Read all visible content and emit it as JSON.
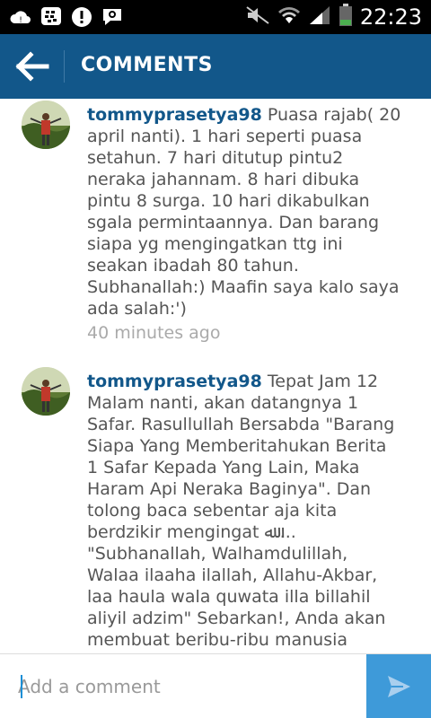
{
  "status_bar": {
    "time": "22:23",
    "icons": [
      "cloud-icon",
      "bbm-icon",
      "alert-icon",
      "chat-icon",
      "mute-icon",
      "wifi-icon",
      "signal-icon",
      "battery-icon"
    ]
  },
  "header": {
    "title": "COMMENTS",
    "back_icon": "back-arrow-icon",
    "background": "#12578a"
  },
  "comments": [
    {
      "username": "tommyprasetya98",
      "text": "Puasa rajab( 20 april nanti). 1 hari seperti puasa setahun. 7 hari ditutup pintu2 neraka jahannam. 8 hari dibuka pintu 8 surga. 10 hari dikabulkan sgala permintaannya. Dan barang siapa yg mengingatkan ttg ini seakan ibadah 80 tahun. Subhanallah:) Maafin saya kalo saya ada salah:')",
      "time": "40 minutes ago"
    },
    {
      "username": "tommyprasetya98",
      "text": "Tepat Jam 12 Malam nanti, akan datangnya 1 Safar. Rasullullah Bersabda \"Barang Siapa Yang Memberitahukan Berita 1 Safar Kepada Yang Lain, Maka Haram Api Neraka Baginya\". Dan tolong baca sebentar aja kita berdzikir mengingat ﷲ ... \"Subhanallah, Walhamdulillah, Walaa ilaaha ilallah, Allahu-Akbar, laa haula wala quwata illa billahil aliyil adzim\" Sebarkan!, Anda  akan membuat beribu-ribu manusia"
    }
  ],
  "composer": {
    "placeholder": "Add a comment",
    "send_icon": "send-icon",
    "send_color": "#3e9ad9"
  },
  "colors": {
    "username": "#12578a",
    "comment_text": "#555555",
    "timestamp": "#aaaaaa"
  }
}
